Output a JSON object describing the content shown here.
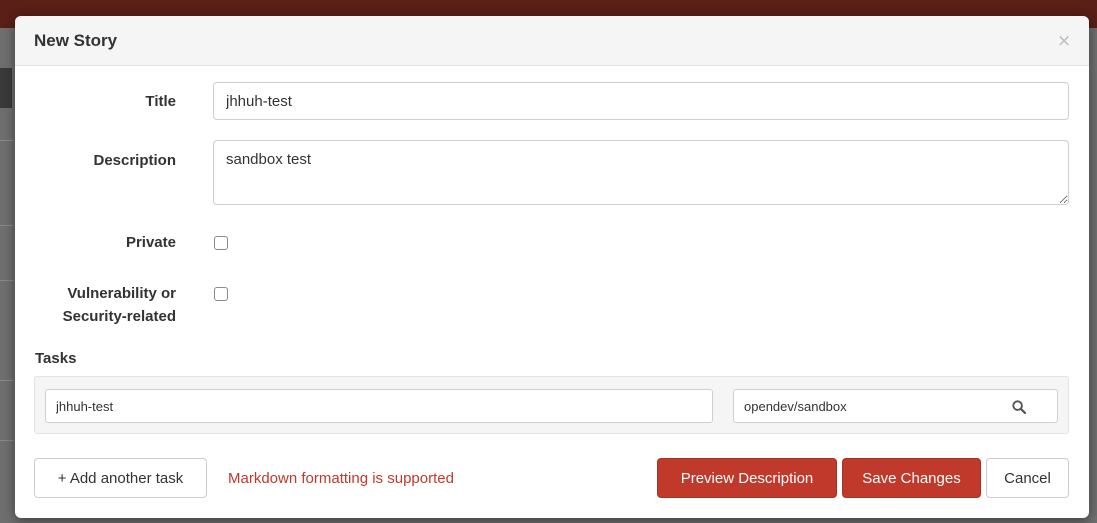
{
  "modal": {
    "title": "New Story",
    "close_symbol": "×"
  },
  "form": {
    "title_label": "Title",
    "title_value": "jhhuh-test",
    "description_label": "Description",
    "description_value": "sandbox test",
    "private_label": "Private",
    "private_checked": false,
    "security_label_line1": "Vulnerability or",
    "security_label_line2": "Security-related",
    "security_checked": false
  },
  "tasks": {
    "label": "Tasks",
    "task_title_value": "jhhuh-test",
    "project_value": "opendev/sandbox",
    "search_icon": "search-icon"
  },
  "footer": {
    "add_task_label": "+ Add another task",
    "markdown_note": "Markdown formatting is supported",
    "preview_label": "Preview Description",
    "save_label": "Save Changes",
    "cancel_label": "Cancel"
  },
  "colors": {
    "brand": "#c0392b",
    "topbar": "#5a1f17"
  }
}
